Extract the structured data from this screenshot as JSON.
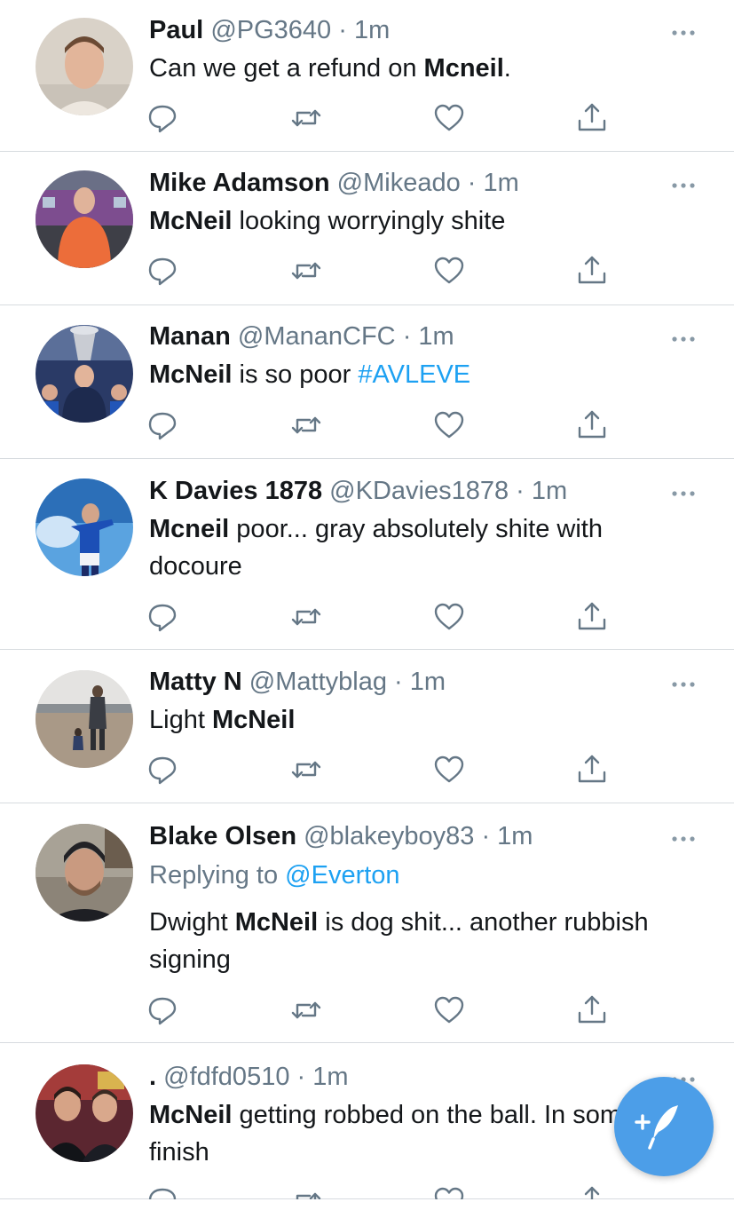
{
  "colors": {
    "link": "#1da1f2",
    "secondary_text": "#657786",
    "primary_text": "#14171a",
    "divider": "#d7dbdf",
    "compose_button": "#4c9ee8"
  },
  "tweets": [
    {
      "name": "Paul",
      "handle": "@PG3640",
      "separator": "·",
      "time": "1m",
      "avatar_icon": "avatar-paul",
      "text_parts": [
        {
          "text": "Can we get a refund on ",
          "bold": false
        },
        {
          "text": "Mcneil",
          "bold": true
        },
        {
          "text": ".",
          "bold": false
        }
      ]
    },
    {
      "name": "Mike Adamson",
      "handle": "@Mikeado",
      "separator": "·",
      "time": "1m",
      "avatar_icon": "avatar-mike-adamson",
      "text_parts": [
        {
          "text": "McNeil",
          "bold": true
        },
        {
          "text": " looking worryingly shite",
          "bold": false
        }
      ]
    },
    {
      "name": "Manan",
      "handle": "@MananCFC",
      "separator": "·",
      "time": "1m",
      "avatar_icon": "avatar-manan",
      "text_parts": [
        {
          "text": "McNeil",
          "bold": true
        },
        {
          "text": " is so poor ",
          "bold": false
        },
        {
          "text": "#AVLEVE",
          "bold": false,
          "hashtag": true
        }
      ]
    },
    {
      "name": "K Davies 1878",
      "handle": "@KDavies1878",
      "separator": "·",
      "time": "1m",
      "avatar_icon": "avatar-k-davies",
      "text_parts": [
        {
          "text": "Mcneil",
          "bold": true
        },
        {
          "text": " poor... gray absolutely shite with docoure",
          "bold": false
        }
      ]
    },
    {
      "name": "Matty N",
      "handle": "@Mattyblag",
      "separator": "·",
      "time": "1m",
      "avatar_icon": "avatar-matty-n",
      "text_parts": [
        {
          "text": "Light ",
          "bold": false
        },
        {
          "text": "McNeil",
          "bold": true
        }
      ]
    },
    {
      "name": "Blake Olsen",
      "handle": "@blakeyboy83",
      "separator": "·",
      "time": "1m",
      "avatar_icon": "avatar-blake-olsen",
      "replying_to_label": "Replying to ",
      "replying_to_handle": "@Everton",
      "text_parts": [
        {
          "text": "Dwight ",
          "bold": false
        },
        {
          "text": "McNeil",
          "bold": true
        },
        {
          "text": " is dog shit... another rubbish signing",
          "bold": false
        }
      ]
    },
    {
      "name": ".",
      "handle": "@fdfd0510",
      "separator": "·",
      "time": "1m",
      "avatar_icon": "avatar-fdfd0510",
      "text_parts": [
        {
          "text": "McNeil",
          "bold": true
        },
        {
          "text": " getting robbed on the ball. In some finish",
          "bold": false
        }
      ]
    }
  ],
  "action_icons": [
    "reply-icon",
    "retweet-icon",
    "like-icon",
    "share-icon"
  ],
  "overflow_icon": "more-options-icon",
  "compose_icon": "compose-tweet-icon"
}
